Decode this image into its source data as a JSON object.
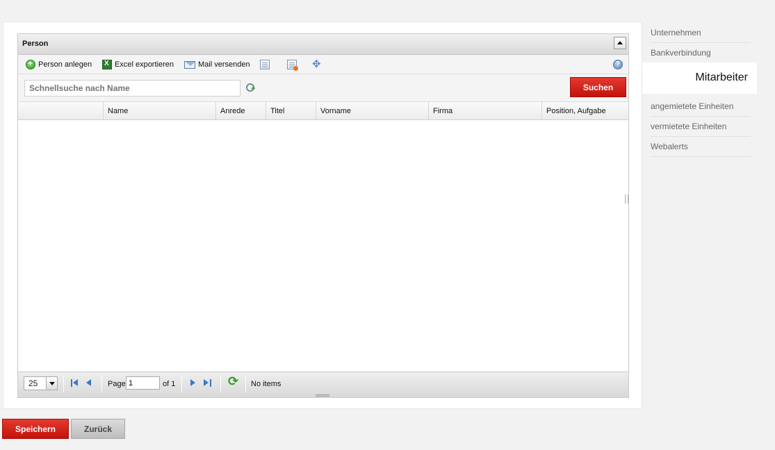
{
  "panel": {
    "title": "Person"
  },
  "toolbar": {
    "add_person": "Person anlegen",
    "excel_export": "Excel exportieren",
    "send_mail": "Mail versenden"
  },
  "search": {
    "placeholder": "Schnellsuche nach Name",
    "button": "Suchen"
  },
  "grid": {
    "columns": [
      "",
      "Name",
      "Anrede",
      "Titel",
      "Vorname",
      "Firma",
      "Position, Aufgabe"
    ],
    "rows": []
  },
  "pager": {
    "page_size": "25",
    "page_label": "Page",
    "current_page": "1",
    "of_label": "of 1",
    "status": "No items"
  },
  "side_nav": {
    "items_top": [
      "Unternehmen",
      "Bankverbindung"
    ],
    "active": "Mitarbeiter",
    "items_bottom": [
      "angemietete Einheiten",
      "vermietete Einheiten",
      "Webalerts"
    ]
  },
  "footer": {
    "save": "Speichern",
    "back": "Zurück"
  },
  "colors": {
    "accent_red": "#d42116",
    "link_blue": "#3b79c8"
  }
}
